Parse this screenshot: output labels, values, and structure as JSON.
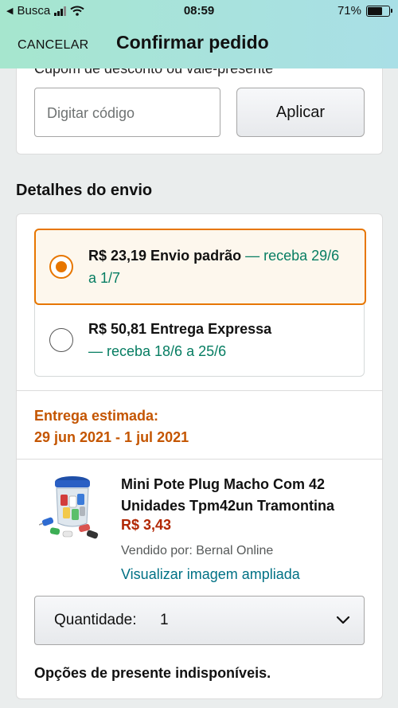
{
  "status_bar": {
    "back_app": "Busca",
    "time": "08:59",
    "battery": "71%",
    "battery_level": 0.71
  },
  "header": {
    "cancel_label": "CANCELAR",
    "title": "Confirmar pedido"
  },
  "coupon": {
    "label": "Cupom de desconto ou vale-presente",
    "input_placeholder": "Digitar código",
    "apply_label": "Aplicar"
  },
  "shipping": {
    "section_title": "Detalhes do envio",
    "options": [
      {
        "price_name": "R$ 23,19 Envio padrão",
        "eta": "— receba 29/6 a 1/7",
        "selected": true
      },
      {
        "price_name": "R$ 50,81 Entrega Expressa",
        "eta": "— receba 18/6 a 25/6",
        "selected": false
      }
    ],
    "estimate_label": "Entrega estimada:",
    "estimate_dates": "29 jun 2021 - 1 jul 2021"
  },
  "product": {
    "title": "Mini Pote Plug Macho Com 42 Unidades Tpm42un Tramontina",
    "price": "R$ 3,43",
    "seller": "Vendido por: Bernal Online",
    "view_image_link": "Visualizar imagem ampliada",
    "quantity_label": "Quantidade:",
    "quantity_value": "1",
    "gift_note": "Opções de presente indisponíveis."
  },
  "colors": {
    "accent_orange": "#e77600",
    "teal": "#067d62",
    "price_red": "#b12704",
    "link_blue": "#007185",
    "header_gradient_start": "#a6e6ce",
    "header_gradient_end": "#a9dfe6"
  }
}
